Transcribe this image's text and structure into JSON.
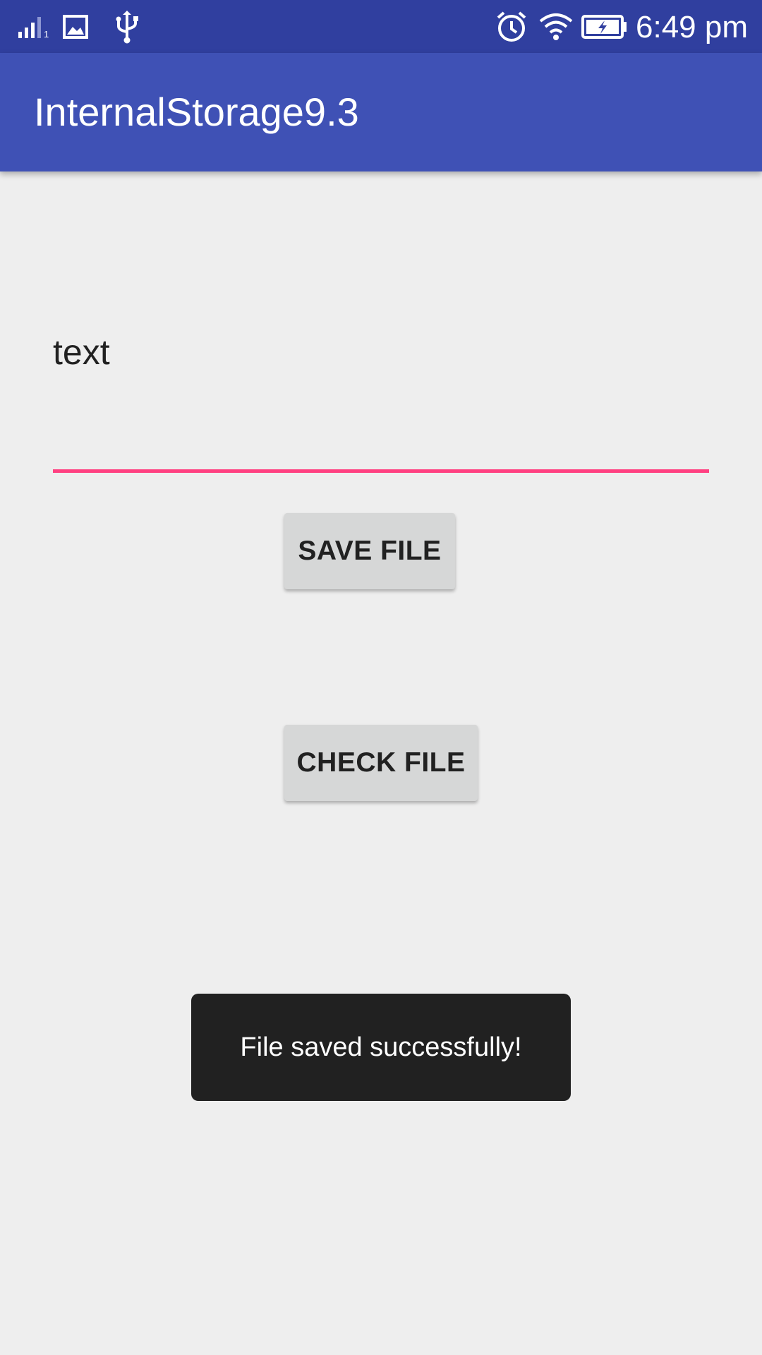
{
  "status_bar": {
    "time": "6:49 pm",
    "sim_indicator": "1",
    "icons": [
      "signal-icon",
      "image-icon",
      "usb-icon",
      "alarm-icon",
      "wifi-icon",
      "battery-charging-icon"
    ],
    "background_color": "#303f9f"
  },
  "app_bar": {
    "title": "InternalStorage9.3",
    "background_color": "#3f51b5"
  },
  "edit_text": {
    "value": "text",
    "underline_color": "#ff4081"
  },
  "buttons": {
    "save_label": "SAVE FILE",
    "check_label": "CHECK FILE"
  },
  "toast": {
    "message": "File saved successfully!"
  }
}
